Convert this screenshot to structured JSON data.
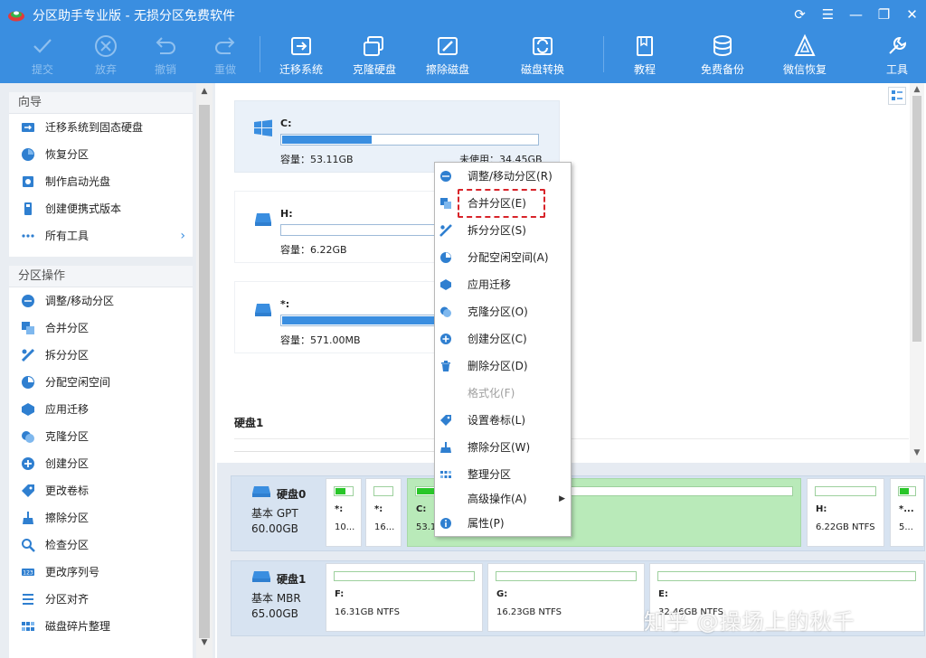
{
  "app": {
    "title": "分区助手专业版 - 无损分区免费软件",
    "window_controls": [
      "refresh-icon",
      "menu-icon",
      "minimize-icon",
      "maximize-icon",
      "close-icon"
    ]
  },
  "toolbar": {
    "commit": {
      "label": "提交",
      "enabled": false
    },
    "discard": {
      "label": "放弃",
      "enabled": false
    },
    "undo": {
      "label": "撤销",
      "enabled": false
    },
    "redo": {
      "label": "重做",
      "enabled": false
    },
    "migrate_os": {
      "label": "迁移系统"
    },
    "clone_disk": {
      "label": "克隆硬盘"
    },
    "wipe_disk": {
      "label": "擦除磁盘"
    },
    "disk_convert": {
      "label": "磁盘转换"
    },
    "tutorial": {
      "label": "教程"
    },
    "free_backup": {
      "label": "免费备份"
    },
    "wechat_recovery": {
      "label": "微信恢复"
    },
    "tools": {
      "label": "工具"
    }
  },
  "sidebar": {
    "wizard": {
      "title": "向导",
      "items": [
        {
          "label": "迁移系统到固态硬盘"
        },
        {
          "label": "恢复分区"
        },
        {
          "label": "制作启动光盘"
        },
        {
          "label": "创建便携式版本"
        },
        {
          "label": "所有工具"
        }
      ]
    },
    "operations": {
      "title": "分区操作",
      "items": [
        {
          "label": "调整/移动分区"
        },
        {
          "label": "合并分区"
        },
        {
          "label": "拆分分区"
        },
        {
          "label": "分配空闲空间"
        },
        {
          "label": "应用迁移"
        },
        {
          "label": "克隆分区"
        },
        {
          "label": "创建分区"
        },
        {
          "label": "更改卷标"
        },
        {
          "label": "擦除分区"
        },
        {
          "label": "检查分区"
        },
        {
          "label": "更改序列号"
        },
        {
          "label": "分区对齐"
        },
        {
          "label": "磁盘碎片整理"
        }
      ]
    }
  },
  "partitions": [
    {
      "name": "C:",
      "capacity": "容量：53.11GB",
      "free": "未使用：34.45GB",
      "used_fraction": 0.35
    },
    {
      "name": "H:",
      "capacity": "容量：6.22GB",
      "used_fraction": 0.0
    },
    {
      "name": "*:",
      "capacity": "容量：571.00MB",
      "used_fraction": 0.85
    }
  ],
  "disk1_header": "硬盘1",
  "disks": [
    {
      "name": "硬盘0",
      "type": "基本 GPT",
      "size": "60.00GB",
      "segments": [
        {
          "name": "*:",
          "info": "10...",
          "fill": 0.6
        },
        {
          "name": "*:",
          "info": "16...",
          "fill": 0.0
        },
        {
          "name": "C:",
          "info": "53.1...",
          "fill": 0.2
        },
        {
          "name": "H:",
          "info": "6.22GB NTFS",
          "fill": 0.0
        },
        {
          "name": "*...",
          "info": "5...",
          "fill": 0.6
        }
      ]
    },
    {
      "name": "硬盘1",
      "type": "基本 MBR",
      "size": "65.00GB",
      "segments": [
        {
          "name": "F:",
          "info": "16.31GB NTFS",
          "fill": 0.0
        },
        {
          "name": "G:",
          "info": "16.23GB NTFS",
          "fill": 0.0
        },
        {
          "name": "E:",
          "info": "32.46GB NTFS",
          "fill": 0.0
        }
      ]
    }
  ],
  "context_menu": {
    "items": [
      {
        "label": "调整/移动分区(R)",
        "icon": "resize-icon"
      },
      {
        "label": "合并分区(E)",
        "icon": "merge-icon"
      },
      {
        "label": "拆分分区(S)",
        "icon": "split-icon"
      },
      {
        "label": "分配空闲空间(A)",
        "icon": "allocate-icon"
      },
      {
        "label": "应用迁移",
        "icon": "migrate-icon"
      },
      {
        "label": "克隆分区(O)",
        "icon": "clone-icon"
      },
      {
        "label": "创建分区(C)",
        "icon": "create-icon"
      },
      {
        "label": "删除分区(D)",
        "icon": "delete-icon"
      },
      {
        "label": "格式化(F)",
        "icon": "",
        "enabled": false
      },
      {
        "label": "设置卷标(L)",
        "icon": "label-icon"
      },
      {
        "label": "擦除分区(W)",
        "icon": "wipe-icon"
      },
      {
        "label": "整理分区",
        "icon": "defrag-icon"
      },
      {
        "label": "高级操作(A)",
        "icon": "",
        "submenu": true
      },
      {
        "label": "属性(P)",
        "icon": "info-icon"
      }
    ],
    "highlighted_item": "合并分区(E)"
  },
  "watermark": "知乎 @操场上的秋千",
  "colors": {
    "toolbar_bg": "#3a8ee0",
    "highlight": "#d8242a",
    "used_bar": "#3a8ee0",
    "partition_fill": "#29c629",
    "selected_segment": "#b9eab9"
  }
}
